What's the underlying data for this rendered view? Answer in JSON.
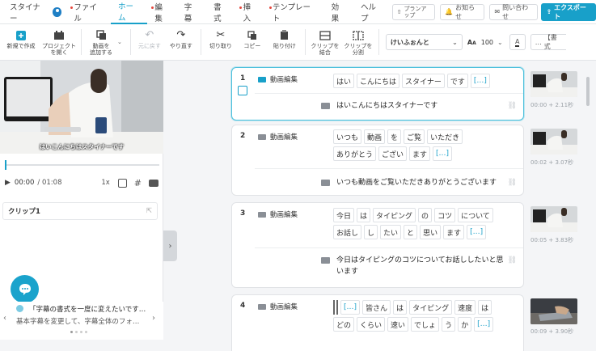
{
  "app": {
    "name": "スタイナー"
  },
  "menu": [
    {
      "label": "ファイル",
      "dot": true
    },
    {
      "label": "ホーム",
      "active": true
    },
    {
      "label": "編集",
      "dot": true
    },
    {
      "label": "字幕"
    },
    {
      "label": "書式"
    },
    {
      "label": "挿入",
      "dot": true
    },
    {
      "label": "テンプレート",
      "dot": true
    },
    {
      "label": "効果"
    },
    {
      "label": "ヘルプ"
    }
  ],
  "right": {
    "plan": "プランア ップ",
    "notice": "お知らせ",
    "contact": "問い合わせ",
    "export": "エクスポート"
  },
  "toolbar": {
    "new_label": "新規で作成",
    "open_label": "プロジェクト を開く",
    "add_video_label": "動画を 追加する",
    "undo_label": "元に戻す",
    "redo_label": "やり直す",
    "cut_label": "切り取り",
    "copy_label": "コピー",
    "paste_label": "貼り付け",
    "merge_label": "クリップを 結合",
    "split_label": "クリップを 分割",
    "font": "けいふぉんと",
    "font_size": "100",
    "more": "【書式"
  },
  "player": {
    "caption": "はいこんにちはスタイナーです",
    "time": "00:00",
    "duration": "/ 01:08",
    "speed": "1x"
  },
  "clip_panel": {
    "title": "クリップ1"
  },
  "tip": {
    "title": "「字幕の書式を一度に変えたいです…",
    "body": "基本字幕を変更して、字幕全体のフォ…"
  },
  "clips": [
    {
      "num": "1",
      "title": "動画編集",
      "tokens": [
        "はい",
        "こんにちは",
        "スタイナー",
        "です",
        "[…]"
      ],
      "subtitle": "はいこんにちはスタイナーです",
      "time": "00:00 + 2.11秒"
    },
    {
      "num": "2",
      "title": "動画編集",
      "tokens": [
        "いつも",
        "動画",
        "を",
        "ご覧",
        "いただき",
        "ありがとう",
        "ござい",
        "ます",
        "[…]"
      ],
      "subtitle": "いつも動画をご覧いただきありがとうございます",
      "time": "00:02 + 3.07秒"
    },
    {
      "num": "3",
      "title": "動画編集",
      "tokens": [
        "今日",
        "は",
        "タイピング",
        "の",
        "コツ",
        "について",
        "お話し",
        "し",
        "たい",
        "と",
        "思い",
        "ます",
        "[…]"
      ],
      "subtitle": "今日はタイピングのコツについてお話ししたいと思います",
      "time": "00:05 + 3.83秒"
    },
    {
      "num": "4",
      "title": "動画編集",
      "tokens": [
        "[…]",
        "皆さん",
        "は",
        "タイピング",
        "速度",
        "は",
        "どの",
        "くらい",
        "速い",
        "でしょ",
        "う",
        "か",
        "[…]"
      ],
      "time": "00:09 + 3.90秒"
    }
  ]
}
